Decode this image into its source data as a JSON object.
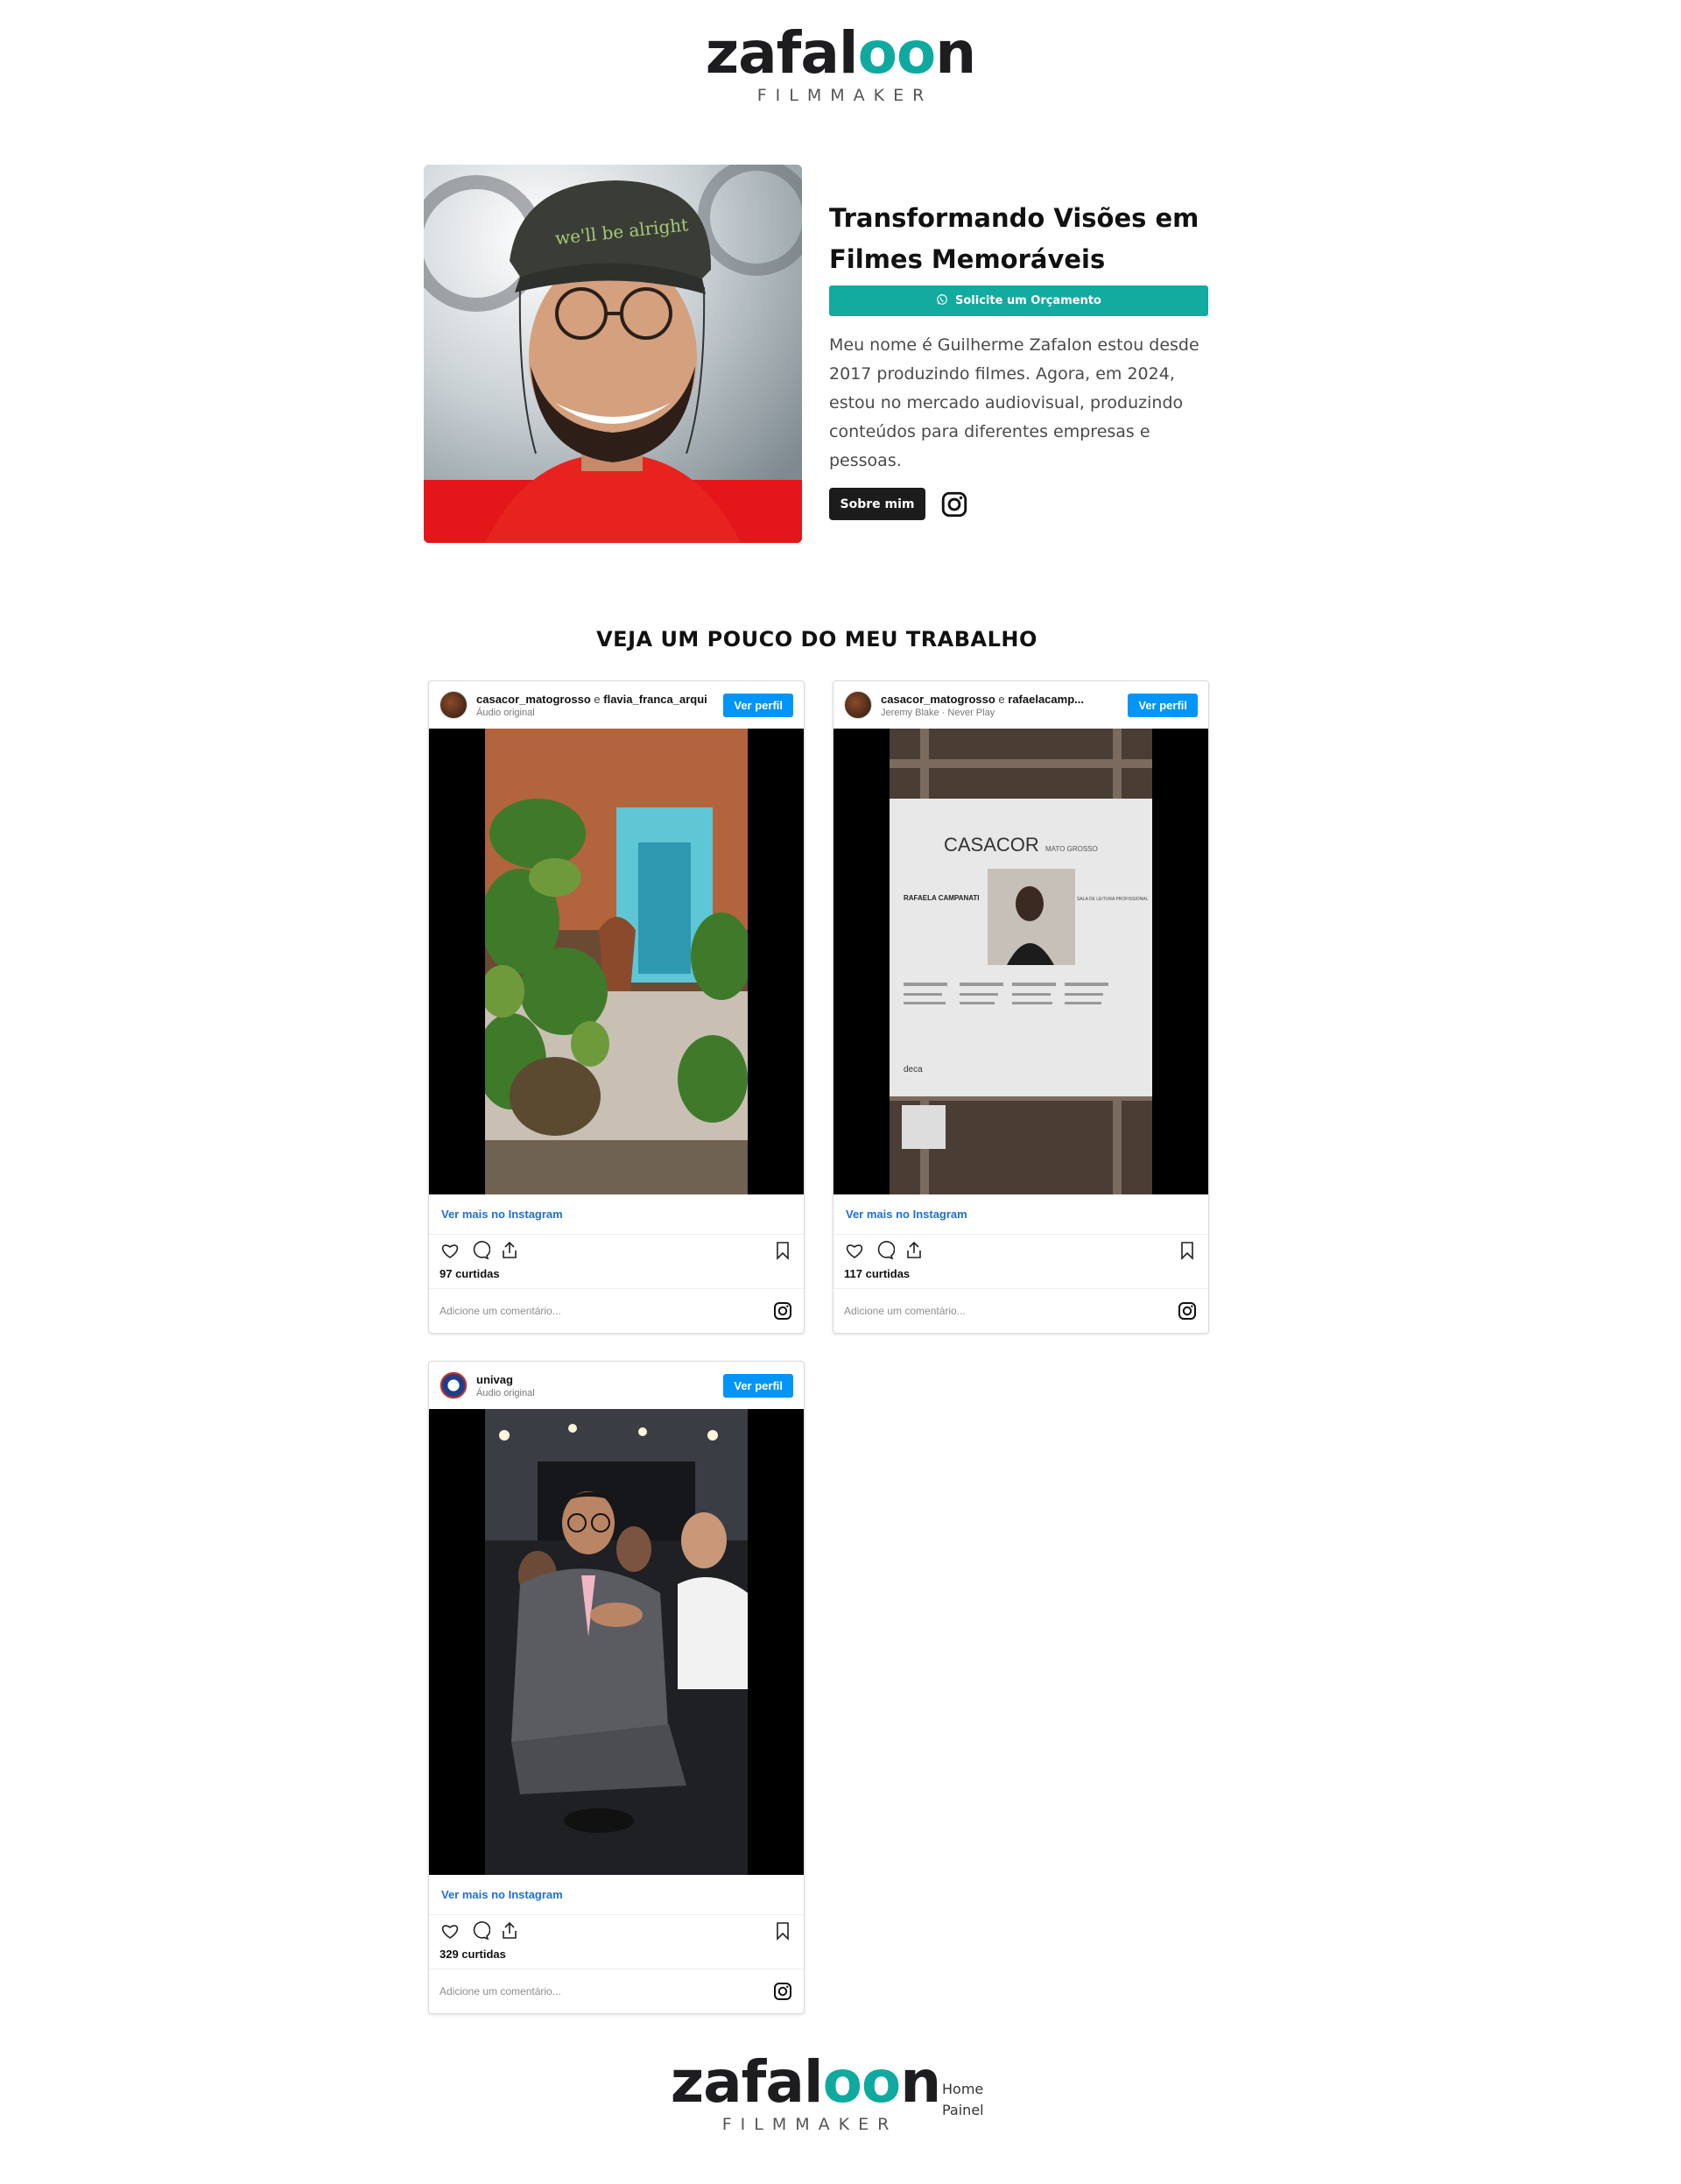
{
  "brand": {
    "name_start": "zafal",
    "name_accent": "oo",
    "name_end": "n",
    "tagline": "FILMMAKER",
    "accent_color": "#0fa9a0"
  },
  "hero": {
    "title": "Transformando Visões em Filmes Memoráveis",
    "cta_label": "Solicite um Orçamento",
    "cta_icon": "whatsapp-icon",
    "description": "Meu nome é Guilherme Zafalon estou desde 2017 produzindo filmes. Agora, em 2024, estou no mercado audiovisual, produzindo conteúdos para diferentes empresas e pessoas.",
    "about_label": "Sobre mim",
    "social_icon": "instagram-icon",
    "cap_text": "we'll be alright"
  },
  "works": {
    "heading": "VEJA UM POUCO DO MEU TRABALHO",
    "posts": [
      {
        "user": "casacor_matogrosso",
        "conj": "e",
        "collab": "flavia_franca_arqui",
        "audio": "Áudio original",
        "view_profile": "Ver perfil",
        "more": "Ver mais no Instagram",
        "likes": "97 curtidas",
        "comment_placeholder": "Adicione um comentário..."
      },
      {
        "user": "casacor_matogrosso",
        "conj": "e",
        "collab": "rafaelacamp...",
        "audio": "Jeremy Blake · Never Play",
        "view_profile": "Ver perfil",
        "more": "Ver mais no Instagram",
        "likes": "117 curtidas",
        "comment_placeholder": "Adicione um comentário...",
        "poster": {
          "brand": "CASACOR",
          "region": "MATO GROSSO",
          "name": "RAFAELA CAMPANATI",
          "room": "SALA DE LEITURA PROFISSIONAL",
          "sponsor": "deca"
        }
      },
      {
        "user": "univag",
        "conj": "",
        "collab": "",
        "audio": "Áudio original",
        "view_profile": "Ver perfil",
        "more": "Ver mais no Instagram",
        "likes": "329 curtidas",
        "comment_placeholder": "Adicione um comentário..."
      }
    ]
  },
  "footer": {
    "nav": [
      "Home",
      "Painel"
    ]
  }
}
